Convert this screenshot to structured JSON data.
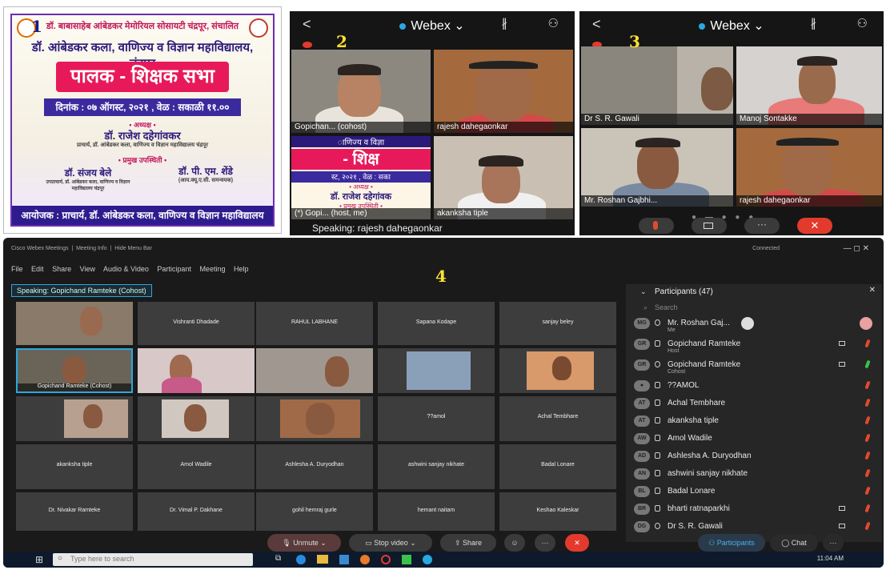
{
  "labels": {
    "p1": "1",
    "p2": "2",
    "p3": "3",
    "p4": "4"
  },
  "poster": {
    "topline": "डॉ. बाबासाहेब आंबेडकर मेमोरियल सोसायटी चंद्रपूर, संचालित",
    "college": "डॉ. आंबेडकर कला, वाणिज्य व विज्ञान महाविद्यालय, चंद्रपूर",
    "title": "पालक - शिक्षक सभा",
    "date": "दिनांक : ०७ ऑगस्ट, २०२१ , वेळ : सकाळी ११.०० वाजता",
    "chair_label": "• अध्यक्ष •",
    "chair_name": "डॉ. राजेश दहेगांवकर",
    "chair_desc": "प्राचार्य, डॉ. आंबेडकर कला, वाणिज्य व विज्ञान महाविद्यालय चंद्रपूर",
    "guest_label": "• प्रमुख उपस्थिती •",
    "guest1_name": "डॉ. संजय बेले",
    "guest1_desc": "उपप्राचार्य, डॉ. आंबेडकर कला, वाणिज्य व विज्ञान महाविद्यालय चंद्रपूर",
    "guest2_name": "डॉ. पी. एम. शेंडे",
    "guest2_desc": "(आय.क्यू.ए.सी. समन्वयक)",
    "footer": "आयोजक : प्राचार्य, डॉ. आंबेडकर कला, वाणिज्य व विज्ञान महाविद्यालय चंद्रपूर"
  },
  "mobile1": {
    "app": "Webex",
    "tiles": [
      "Gopichan... (cohost)",
      "rajesh dahegaonkar",
      "(*) Gopi... (host, me)",
      "akanksha tiple"
    ],
    "speaking": "Speaking: rajesh dahegaonkar",
    "poster_line1": "ाणिज्य व विज्ञा",
    "poster_line2": "- शिक्ष",
    "poster_line3": "स्ट, २०२१ , वेळ : सका",
    "poster_line4": "• अध्यक्ष •",
    "poster_line5": "डॉ. राजेश दहेगांवक",
    "poster_line6": "• प्रमुख उपस्थिती •"
  },
  "mobile2": {
    "app": "Webex",
    "tiles": [
      "Dr S. R. Gawali",
      "Manoj Sontakke",
      "Mr. Roshan Gajbhi...",
      "rajesh dahegaonkar"
    ]
  },
  "desktop": {
    "menubar": [
      "Cisco Webex Meetings",
      "Meeting Info",
      "Hide Menu Bar"
    ],
    "menus": [
      "File",
      "Edit",
      "Share",
      "View",
      "Audio & Video",
      "Participant",
      "Meeting",
      "Help"
    ],
    "speaking": "Speaking: Gopichand Ramteke (Cohost)",
    "connected": "Connected",
    "grid_names": [
      "Vishranti Dhadade",
      "RAHUL LABHANE",
      "Sapana Kodape",
      "sanjay beley",
      "Gopichand Ramteke (Cohost)",
      "??amol",
      "Achal Tembhare",
      "akanksha tiple",
      "Amol Wadile",
      "Ashlesha A. Duryodhan",
      "ashwini sanjay nikhate",
      "Badal Lonare",
      "Dr. Nivakar Ramteke",
      "Dr. Vimal P. Dakhane",
      "gohil hemraj gurle",
      "hemant naitam",
      "Keshao Kaleskar"
    ],
    "participants_title": "Participants (47)",
    "search_placeholder": "Search",
    "participants": [
      {
        "initials": "MG",
        "name": "Mr. Roshan Gaj...",
        "role": "Me"
      },
      {
        "initials": "GR",
        "name": "Gopichand Ramteke",
        "role": "Host"
      },
      {
        "initials": "GR",
        "name": "Gopichand Ramteke",
        "role": "Cohost"
      },
      {
        "initials": "",
        "name": "??AMOL",
        "role": ""
      },
      {
        "initials": "AT",
        "name": "Achal Tembhare",
        "role": ""
      },
      {
        "initials": "AT",
        "name": "akanksha tiple",
        "role": ""
      },
      {
        "initials": "AW",
        "name": "Amol Wadile",
        "role": ""
      },
      {
        "initials": "AD",
        "name": "Ashlesha A. Duryodhan",
        "role": ""
      },
      {
        "initials": "AN",
        "name": "ashwini sanjay nikhate",
        "role": ""
      },
      {
        "initials": "BL",
        "name": "Badal Lonare",
        "role": ""
      },
      {
        "initials": "BR",
        "name": "bharti ratnaparkhi",
        "role": ""
      },
      {
        "initials": "DG",
        "name": "Dr S. R. Gawali",
        "role": ""
      }
    ],
    "controls": [
      "Unmute",
      "Stop video",
      "Share"
    ],
    "tabs": [
      "Participants",
      "Chat"
    ],
    "taskbar_search": "Type here to search",
    "clock": "11:04 AM"
  }
}
